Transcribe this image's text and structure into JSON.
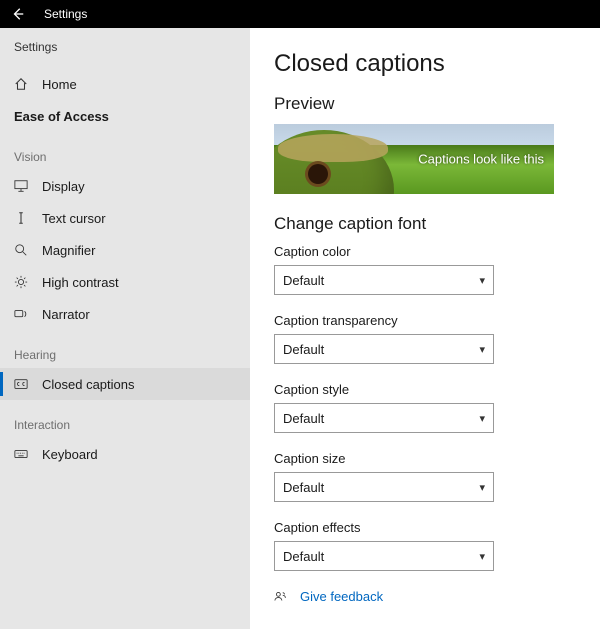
{
  "titlebar": {
    "title": "Settings"
  },
  "sidebar": {
    "header": "Settings",
    "home": "Home",
    "category": "Ease of Access",
    "groups": [
      {
        "label": "Vision",
        "items": [
          "Display",
          "Text cursor",
          "Magnifier",
          "High contrast",
          "Narrator"
        ]
      },
      {
        "label": "Hearing",
        "items": [
          "Closed captions"
        ]
      },
      {
        "label": "Interaction",
        "items": [
          "Keyboard"
        ]
      }
    ]
  },
  "main": {
    "title": "Closed captions",
    "preview_heading": "Preview",
    "preview_caption": "Captions look like this",
    "section_heading": "Change caption font",
    "settings": [
      {
        "label": "Caption color",
        "value": "Default"
      },
      {
        "label": "Caption transparency",
        "value": "Default"
      },
      {
        "label": "Caption style",
        "value": "Default"
      },
      {
        "label": "Caption size",
        "value": "Default"
      },
      {
        "label": "Caption effects",
        "value": "Default"
      }
    ],
    "feedback": "Give feedback"
  }
}
